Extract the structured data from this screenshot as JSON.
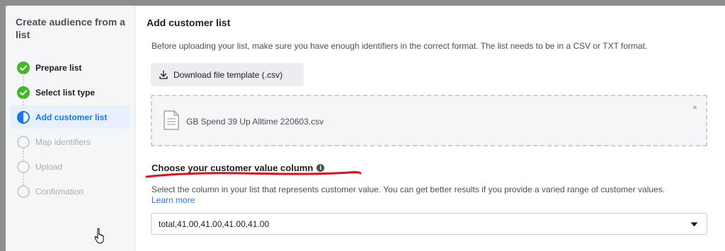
{
  "sidebar": {
    "title": "Create audience from a list",
    "steps": [
      {
        "label": "Prepare list",
        "state": "done"
      },
      {
        "label": "Select list type",
        "state": "done"
      },
      {
        "label": "Add customer list",
        "state": "active"
      },
      {
        "label": "Map identifiers",
        "state": "disabled"
      },
      {
        "label": "Upload",
        "state": "disabled"
      },
      {
        "label": "Confirmation",
        "state": "disabled"
      }
    ]
  },
  "main": {
    "title": "Add customer list",
    "instructions": "Before uploading your list, make sure you have enough identifiers in the correct format. The list needs to be in a CSV or TXT format.",
    "download_button": "Download file template (.csv)",
    "file": {
      "name": "GB Spend 39 Up Alltime 220603.csv",
      "close_symbol": "×"
    },
    "value_column": {
      "heading": "Choose your customer value column",
      "description": "Select the column in your list that represents customer value. You can get better results if you provide a varied range of customer values.",
      "learn_more": "Learn more",
      "selected_value": "total,41.00,41.00,41.00,41.00"
    }
  },
  "colors": {
    "success": "#42b72a",
    "accent": "#1877f2",
    "annotation": "#e0101a"
  },
  "icons": [
    "check-circle-icon",
    "half-circle-icon",
    "empty-circle-icon",
    "download-icon",
    "file-icon",
    "close-icon",
    "info-icon",
    "caret-down-icon",
    "hand-cursor-icon"
  ]
}
